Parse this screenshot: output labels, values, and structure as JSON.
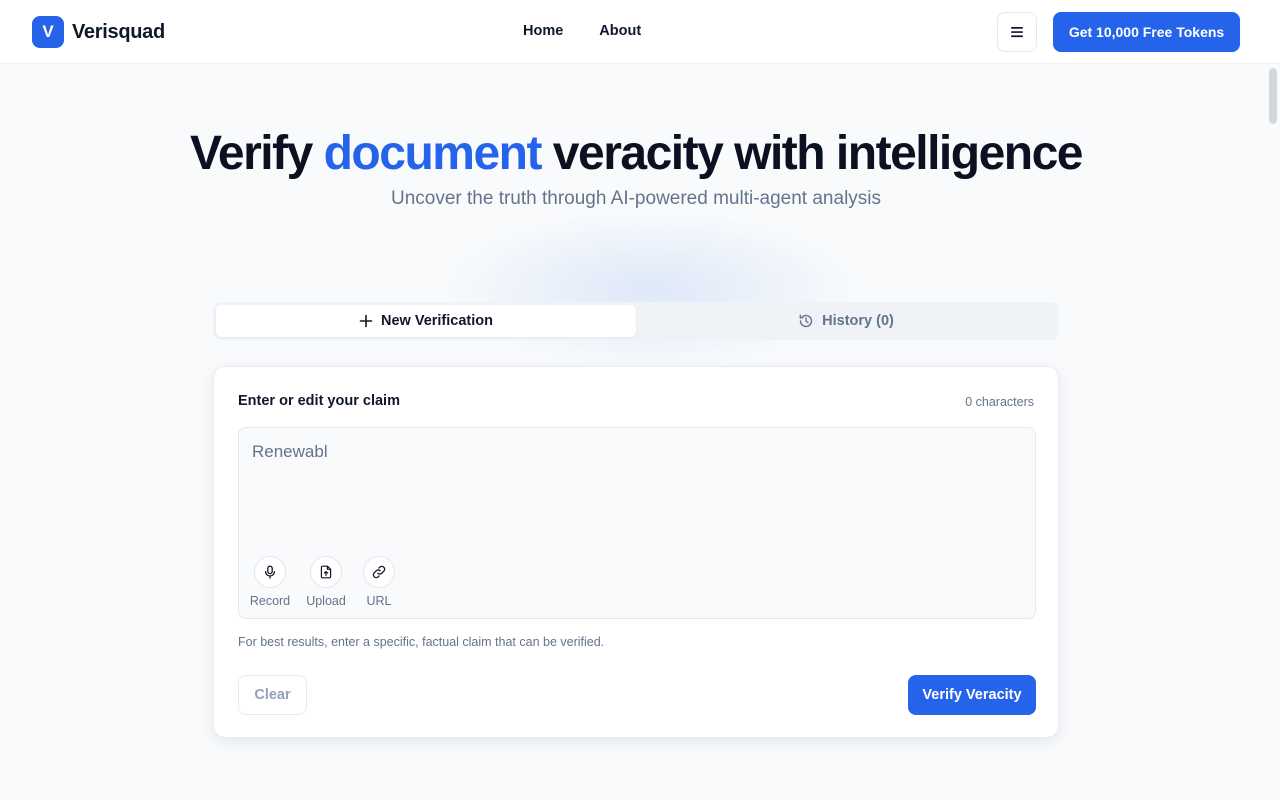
{
  "header": {
    "logo_letter": "V",
    "brand": "Verisquad",
    "nav": [
      "Home",
      "About"
    ],
    "cta_label": "Get 10,000 Free Tokens"
  },
  "hero": {
    "title_pre": "Verify",
    "title_accent": "document",
    "title_post": "veracity with intelligence",
    "subtitle": "Uncover the truth through AI-powered multi-agent analysis"
  },
  "tabs": [
    {
      "label": "New Verification",
      "icon": "plus-icon",
      "active": true
    },
    {
      "label": "History (0)",
      "icon": "history-icon",
      "active": false
    }
  ],
  "form": {
    "label": "Enter or edit your claim",
    "char_count": "0 characters",
    "input_value": "Renewabl",
    "tools": [
      {
        "label": "Record",
        "icon": "microphone-icon"
      },
      {
        "label": "Upload",
        "icon": "file-upload-icon"
      },
      {
        "label": "URL",
        "icon": "link-icon"
      }
    ],
    "hint": "For best results, enter a specific, factual claim that can be verified.",
    "clear_label": "Clear",
    "verify_label": "Verify Veracity"
  },
  "colors": {
    "accent": "#2563eb",
    "text": "#0f172a",
    "muted": "#64748b",
    "background": "#f8fafc"
  }
}
